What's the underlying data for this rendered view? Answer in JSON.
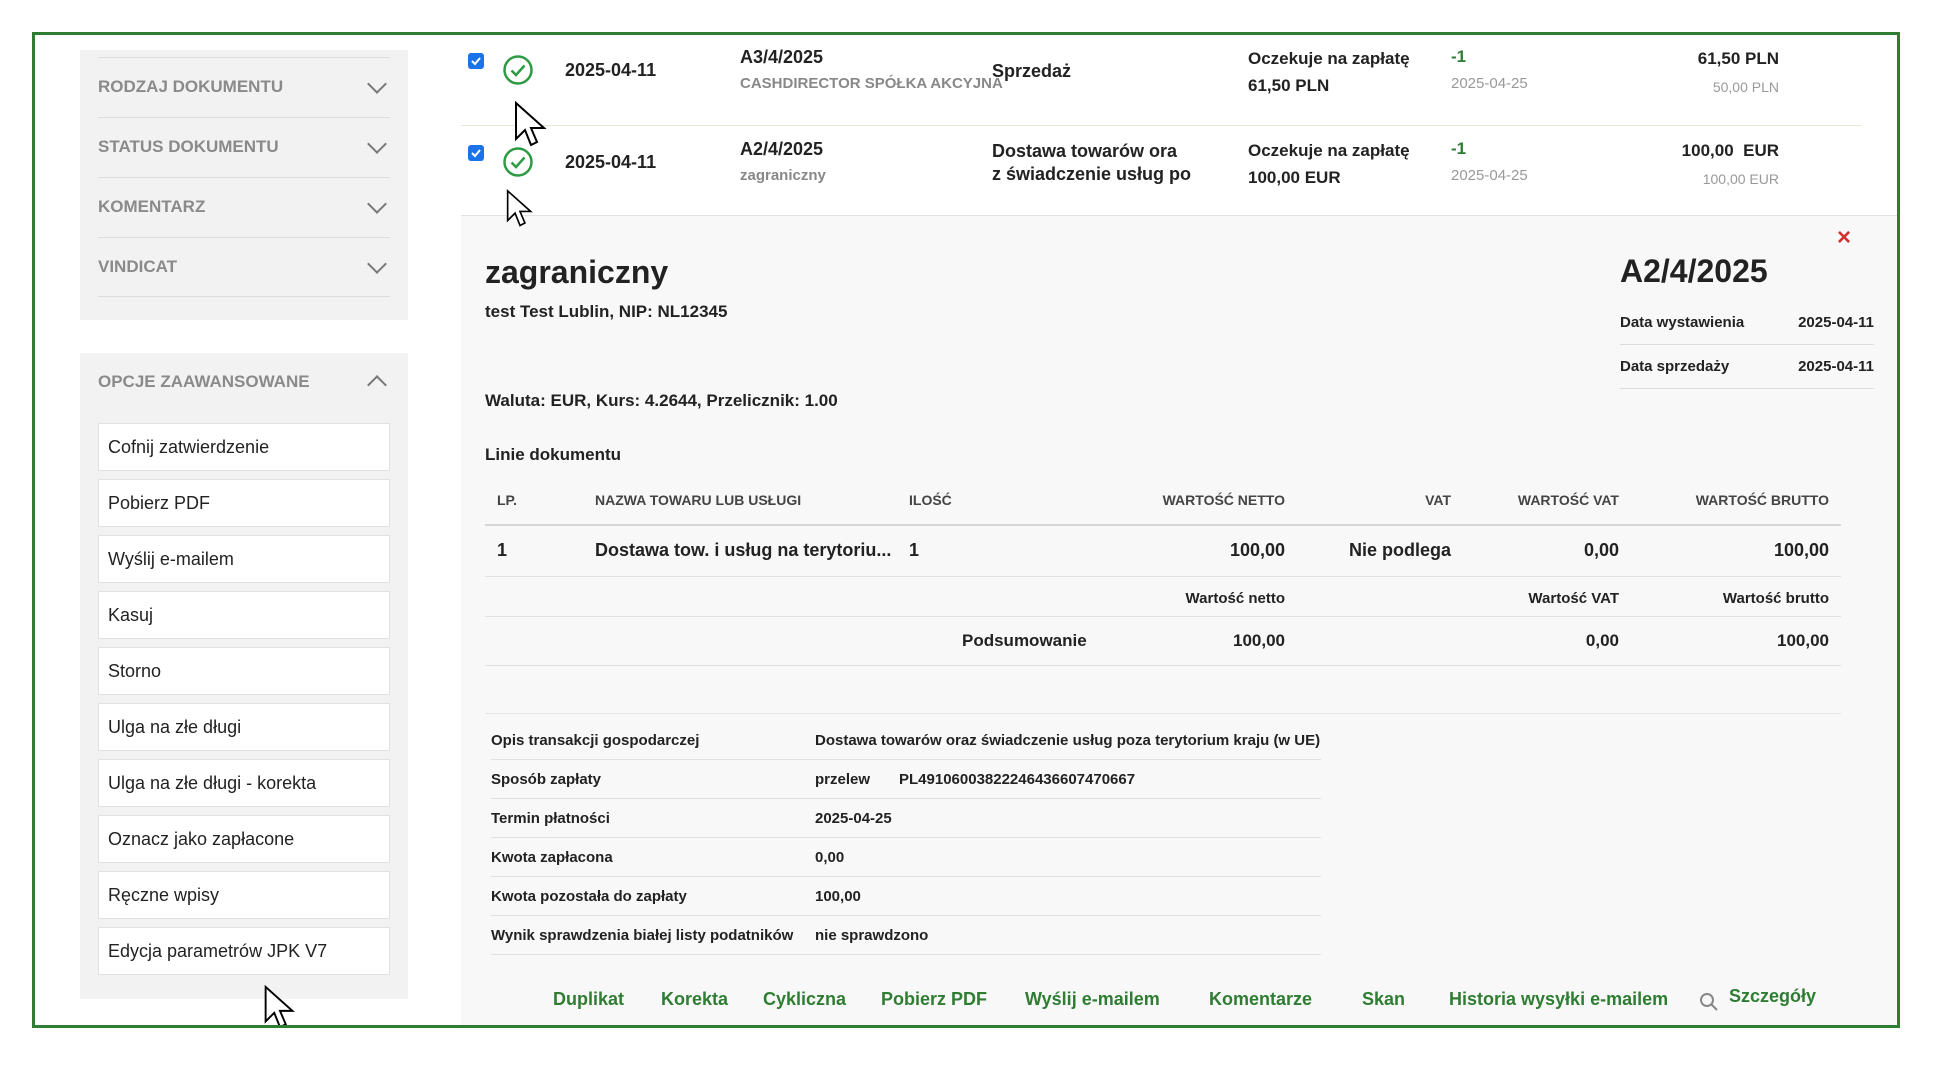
{
  "sidebar": {
    "filters": [
      {
        "label": "RODZAJ DOKUMENTU"
      },
      {
        "label": "STATUS DOKUMENTU"
      },
      {
        "label": "KOMENTARZ"
      },
      {
        "label": "VINDICAT"
      }
    ],
    "advanced": {
      "title": "OPCJE ZAAWANSOWANE",
      "buttons": [
        "Cofnij zatwierdzenie",
        "Pobierz PDF",
        "Wyślij e-mailem",
        "Kasuj",
        "Storno",
        "Ulga na złe długi",
        "Ulga na złe długi - korekta",
        "Oznacz jako zapłacone",
        "Ręczne wpisy",
        "Edycja parametrów JPK V7"
      ]
    }
  },
  "rows": [
    {
      "date": "2025-04-11",
      "number": "A3/4/2025",
      "customer": "CASHDIRECTOR SPÓŁKA AKCYJNA",
      "type_line1": "Sprzedaż",
      "type_line2": "",
      "status": "Oczekuje na zapłatę",
      "status_amount": "61,50 PLN",
      "days": "-1",
      "due": "2025-04-25",
      "amount": "61,50 PLN",
      "amount_net": "50,00 PLN"
    },
    {
      "date": "2025-04-11",
      "number": "A2/4/2025",
      "customer": "zagraniczny",
      "type_line1": "Dostawa towarów ora",
      "type_line2": "z świadczenie usług po",
      "status": "Oczekuje na zapłatę",
      "status_amount": "100,00 EUR",
      "days": "-1",
      "due": "2025-04-25",
      "amount": "100,00  EUR",
      "amount_net": "100,00 EUR"
    }
  ],
  "detail": {
    "close": "×",
    "customer": "zagraniczny",
    "subtitle": "test Test Lublin, NIP: NL12345",
    "doc_number": "A2/4/2025",
    "issue_label": "Data wystawienia",
    "issue_date": "2025-04-11",
    "sale_label": "Data sprzedaży",
    "sale_date": "2025-04-11",
    "currency_line": "Waluta: EUR, Kurs: 4.2644, Przelicznik: 1.00",
    "lines_title": "Linie dokumentu",
    "table": {
      "headers": [
        "LP.",
        "NAZWA TOWARU LUB USŁUGI",
        "ILOŚĆ",
        "WARTOŚĆ NETTO",
        "VAT",
        "WARTOŚĆ VAT",
        "WARTOŚĆ BRUTTO"
      ],
      "row": [
        "1",
        "Dostawa tow. i usług na terytoriu...",
        "1",
        "100,00",
        "Nie podlega",
        "0,00",
        "100,00"
      ],
      "sum_headers": [
        "Wartość netto",
        "Wartość VAT",
        "Wartość brutto"
      ],
      "sum_label": "Podsumowanie",
      "sum_values": [
        "100,00",
        "0,00",
        "100,00"
      ]
    },
    "info": [
      {
        "label": "Opis transakcji gospodarczej",
        "value": "Dostawa towarów oraz świadczenie usług poza terytorium kraju (w UE)",
        "value2": ""
      },
      {
        "label": "Sposób zapłaty",
        "value": "przelew",
        "value2": "PL49106003822246436607470667"
      },
      {
        "label": "Termin płatności",
        "value": "2025-04-25",
        "value2": ""
      },
      {
        "label": "Kwota zapłacona",
        "value": "0,00",
        "value2": ""
      },
      {
        "label": "Kwota pozostała do zapłaty",
        "value": "100,00",
        "value2": ""
      },
      {
        "label": "Wynik sprawdzenia białej listy podatników",
        "value": "nie sprawdzono",
        "value2": ""
      }
    ],
    "actions": [
      "Duplikat",
      "Korekta",
      "Cykliczna",
      "Pobierz PDF",
      "Wyślij e-mailem",
      "Komentarze",
      "Skan",
      "Historia wysyłki e-mailem",
      "Szczegóły"
    ]
  },
  "colors": {
    "accent": "#2e7d32",
    "close": "#d32f2f",
    "checkbox": "#1a73e8"
  }
}
